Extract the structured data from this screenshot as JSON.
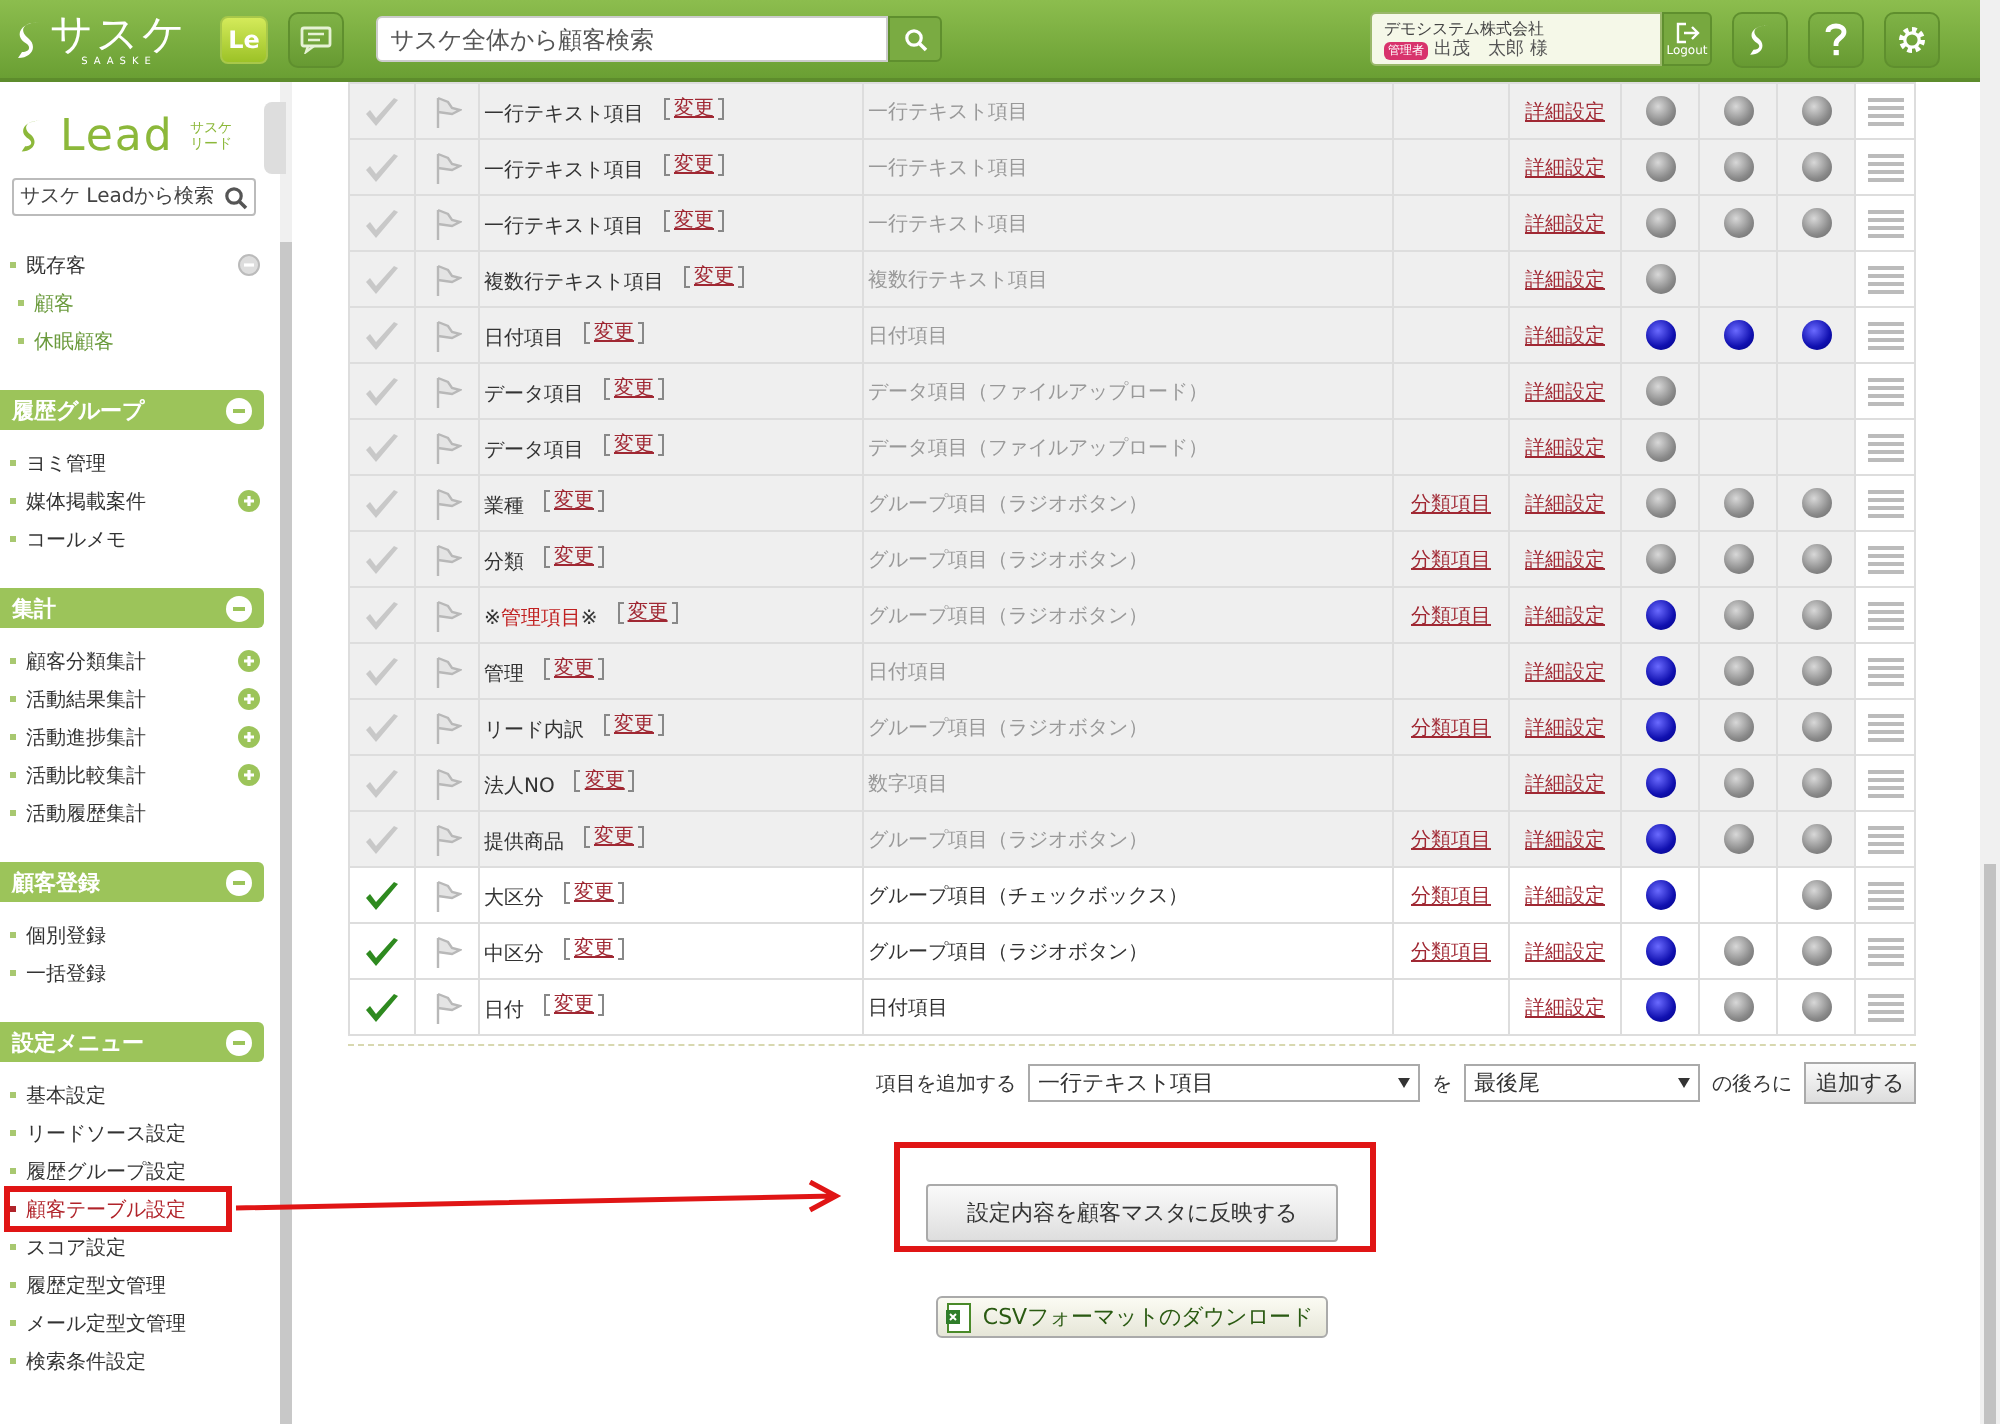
{
  "header": {
    "logo": {
      "name": "サスケ",
      "sub": "SAASKE"
    },
    "app_badge": "Le",
    "search": {
      "placeholder": "サスケ全体から顧客検索"
    },
    "user": {
      "company": "デモシステム株式会社",
      "role": "管理者",
      "name": "出茂　太郎 様"
    },
    "logout": "Logout"
  },
  "sidebar": {
    "logo": {
      "name": "Lead",
      "sub": [
        "サスケ",
        "リード"
      ]
    },
    "search": {
      "placeholder": "サスケ Leadから検索"
    },
    "groups": [
      {
        "items": [
          {
            "label": "既存客",
            "selected": false,
            "plus": false,
            "expanded": true,
            "children": [
              {
                "label": "顧客",
                "selected": false
              },
              {
                "label": "休眠顧客",
                "selected": false
              }
            ]
          }
        ]
      },
      {
        "title": "履歴グループ",
        "expanded": true,
        "items": [
          {
            "label": "ヨミ管理",
            "selected": false,
            "plus": false
          },
          {
            "label": "媒体掲載案件",
            "selected": false,
            "plus": true
          },
          {
            "label": "コールメモ",
            "selected": false,
            "plus": false
          }
        ]
      },
      {
        "title": "集計",
        "expanded": true,
        "items": [
          {
            "label": "顧客分類集計",
            "selected": false,
            "plus": true
          },
          {
            "label": "活動結果集計",
            "selected": false,
            "plus": true
          },
          {
            "label": "活動進捗集計",
            "selected": false,
            "plus": true
          },
          {
            "label": "活動比較集計",
            "selected": false,
            "plus": true
          },
          {
            "label": "活動履歴集計",
            "selected": false,
            "plus": false
          }
        ]
      },
      {
        "title": "顧客登録",
        "expanded": true,
        "items": [
          {
            "label": "個別登録",
            "selected": false,
            "plus": false
          },
          {
            "label": "一括登録",
            "selected": false,
            "plus": false
          }
        ]
      },
      {
        "title": "設定メニュー",
        "expanded": true,
        "items": [
          {
            "label": "基本設定",
            "selected": false,
            "plus": false
          },
          {
            "label": "リードソース設定",
            "selected": false,
            "plus": false
          },
          {
            "label": "履歴グループ設定",
            "selected": false,
            "plus": false
          },
          {
            "label": "顧客テーブル設定",
            "selected": true,
            "plus": false
          },
          {
            "label": "スコア設定",
            "selected": false,
            "plus": false
          },
          {
            "label": "履歴定型文管理",
            "selected": false,
            "plus": false
          },
          {
            "label": "メール定型文管理",
            "selected": false,
            "plus": false
          },
          {
            "label": "検索条件設定",
            "selected": false,
            "plus": false
          }
        ]
      }
    ]
  },
  "table": {
    "rows": [
      {
        "checked": false,
        "name": [
          "一行テキスト項目"
        ],
        "change": "変更",
        "type": "一行テキスト項目",
        "detail": "詳細設定",
        "dots": [
          {
            "shown": true,
            "active": false
          },
          {
            "shown": true,
            "active": false
          },
          {
            "shown": true,
            "active": false
          }
        ]
      },
      {
        "checked": false,
        "name": [
          "一行テキスト項目"
        ],
        "change": "変更",
        "type": "一行テキスト項目",
        "detail": "詳細設定",
        "dots": [
          {
            "shown": true,
            "active": false
          },
          {
            "shown": true,
            "active": false
          },
          {
            "shown": true,
            "active": false
          }
        ]
      },
      {
        "checked": false,
        "name": [
          "一行テキスト項目"
        ],
        "change": "変更",
        "type": "一行テキスト項目",
        "detail": "詳細設定",
        "dots": [
          {
            "shown": true,
            "active": false
          },
          {
            "shown": true,
            "active": false
          },
          {
            "shown": true,
            "active": false
          }
        ]
      },
      {
        "checked": false,
        "name": [
          "複数行テキスト項目"
        ],
        "change": "変更",
        "type": "複数行テキスト項目",
        "detail": "詳細設定",
        "dots": [
          {
            "shown": true,
            "active": false
          },
          {
            "shown": false
          },
          {
            "shown": false
          }
        ]
      },
      {
        "checked": false,
        "name": [
          "日付項目"
        ],
        "change": "変更",
        "type": "日付項目",
        "detail": "詳細設定",
        "dots": [
          {
            "shown": true,
            "active": true
          },
          {
            "shown": true,
            "active": true
          },
          {
            "shown": true,
            "active": true
          }
        ]
      },
      {
        "checked": false,
        "name": [
          "データ項目"
        ],
        "change": "変更",
        "type": "データ項目（ファイルアップロード）",
        "detail": "詳細設定",
        "dots": [
          {
            "shown": true,
            "active": false
          },
          {
            "shown": false
          },
          {
            "shown": false
          }
        ]
      },
      {
        "checked": false,
        "name": [
          "データ項目"
        ],
        "change": "変更",
        "type": "データ項目（ファイルアップロード）",
        "detail": "詳細設定",
        "dots": [
          {
            "shown": true,
            "active": false
          },
          {
            "shown": false
          },
          {
            "shown": false
          }
        ]
      },
      {
        "checked": false,
        "name": [
          "業種"
        ],
        "change": "変更",
        "type": "グループ項目（ラジオボタン）",
        "category": "分類項目",
        "detail": "詳細設定",
        "dots": [
          {
            "shown": true,
            "active": false
          },
          {
            "shown": true,
            "active": false
          },
          {
            "shown": true,
            "active": false
          }
        ]
      },
      {
        "checked": false,
        "name": [
          "分類"
        ],
        "change": "変更",
        "type": "グループ項目（ラジオボタン）",
        "category": "分類項目",
        "detail": "詳細設定",
        "dots": [
          {
            "shown": true,
            "active": false
          },
          {
            "shown": true,
            "active": false
          },
          {
            "shown": true,
            "active": false
          }
        ]
      },
      {
        "checked": false,
        "name": [
          "※",
          "管理項目",
          "※"
        ],
        "change": "変更",
        "type": "グループ項目（ラジオボタン）",
        "category": "分類項目",
        "detail": "詳細設定",
        "dots": [
          {
            "shown": true,
            "active": true
          },
          {
            "shown": true,
            "active": false
          },
          {
            "shown": true,
            "active": false
          }
        ]
      },
      {
        "checked": false,
        "name": [
          "管理"
        ],
        "change": "変更",
        "type": "日付項目",
        "detail": "詳細設定",
        "dots": [
          {
            "shown": true,
            "active": true
          },
          {
            "shown": true,
            "active": false
          },
          {
            "shown": true,
            "active": false
          }
        ]
      },
      {
        "checked": false,
        "name": [
          "リード内訳"
        ],
        "change": "変更",
        "type": "グループ項目（ラジオボタン）",
        "category": "分類項目",
        "detail": "詳細設定",
        "dots": [
          {
            "shown": true,
            "active": true
          },
          {
            "shown": true,
            "active": false
          },
          {
            "shown": true,
            "active": false
          }
        ]
      },
      {
        "checked": false,
        "name": [
          "法人NO"
        ],
        "change": "変更",
        "type": "数字項目",
        "detail": "詳細設定",
        "dots": [
          {
            "shown": true,
            "active": true
          },
          {
            "shown": true,
            "active": false
          },
          {
            "shown": true,
            "active": false
          }
        ]
      },
      {
        "checked": false,
        "name": [
          "提供商品"
        ],
        "change": "変更",
        "type": "グループ項目（ラジオボタン）",
        "category": "分類項目",
        "detail": "詳細設定",
        "dots": [
          {
            "shown": true,
            "active": true
          },
          {
            "shown": true,
            "active": false
          },
          {
            "shown": true,
            "active": false
          }
        ]
      },
      {
        "checked": true,
        "name": [
          "大区分"
        ],
        "change": "変更",
        "type": "グループ項目（チェックボックス）",
        "category": "分類項目",
        "detail": "詳細設定",
        "dots": [
          {
            "shown": true,
            "active": true
          },
          {
            "shown": false
          },
          {
            "shown": true,
            "active": false
          }
        ]
      },
      {
        "checked": true,
        "name": [
          "中区分"
        ],
        "change": "変更",
        "type": "グループ項目（ラジオボタン）",
        "category": "分類項目",
        "detail": "詳細設定",
        "dots": [
          {
            "shown": true,
            "active": true
          },
          {
            "shown": true,
            "active": false
          },
          {
            "shown": true,
            "active": false
          }
        ]
      },
      {
        "checked": true,
        "name": [
          "日付"
        ],
        "change": "変更",
        "type": "日付項目",
        "detail": "詳細設定",
        "dots": [
          {
            "shown": true,
            "active": true
          },
          {
            "shown": true,
            "active": false
          },
          {
            "shown": true,
            "active": false
          }
        ]
      }
    ]
  },
  "add_row": {
    "label": "項目を追加する",
    "type_select": "一行テキスト項目",
    "joiner": "を",
    "position_select": "最後尾",
    "suffix": "の後ろに",
    "button": "追加する"
  },
  "apply_button": "設定内容を顧客マスタに反映する",
  "csv_button": "CSVフォーマットのダウンロード"
}
